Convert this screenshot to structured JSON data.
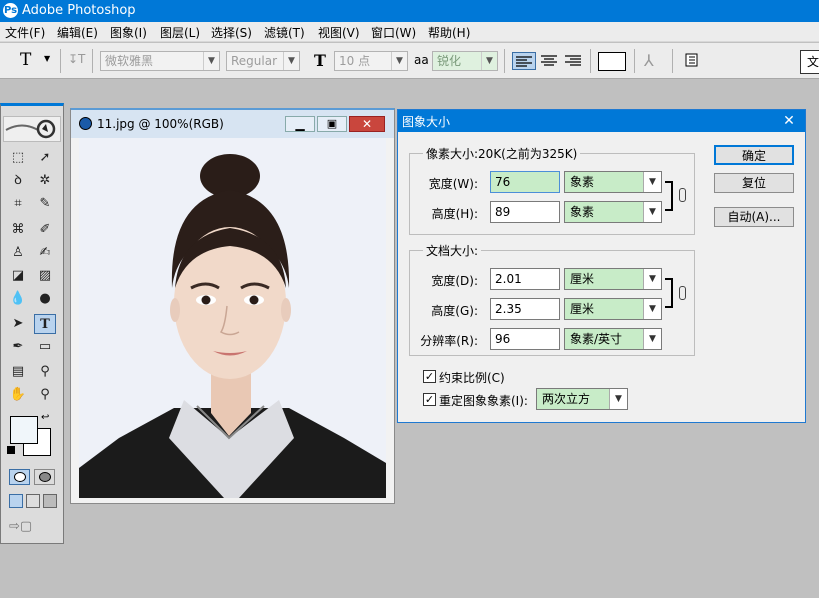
{
  "app": {
    "title": "Adobe Photoshop",
    "icon": "photoshop-icon"
  },
  "menu": [
    "文件(F)",
    "编辑(E)",
    "图象(I)",
    "图层(L)",
    "选择(S)",
    "滤镜(T)",
    "视图(V)",
    "窗口(W)",
    "帮助(H)"
  ],
  "options": {
    "tool_glyph": "T",
    "font_family": "微软雅黑",
    "font_style": "Regular",
    "size_icon": "T",
    "font_size": "10 点",
    "aa_icon": "aa",
    "antialias": "锐化",
    "right_tab": "文"
  },
  "document": {
    "title": "11.jpg @ 100%(RGB)"
  },
  "dialog": {
    "title": "图象大小",
    "pixel_group": "像素大小:20K(之前为325K)",
    "width_label": "宽度(W):",
    "width_value": "76",
    "width_unit": "象素",
    "height_label": "高度(H):",
    "height_value": "89",
    "height_unit": "象素",
    "doc_group": "文档大小:",
    "doc_width_label": "宽度(D):",
    "doc_width_value": "2.01",
    "doc_width_unit": "厘米",
    "doc_height_label": "高度(G):",
    "doc_height_value": "2.35",
    "doc_height_unit": "厘米",
    "resolution_label": "分辨率(R):",
    "resolution_value": "96",
    "resolution_unit": "象素/英寸",
    "constrain_label": "约束比例(C)",
    "constrain_checked": true,
    "resample_label": "重定图象象素(I):",
    "resample_checked": true,
    "resample_method": "两次立方",
    "ok_label": "确定",
    "reset_label": "复位",
    "auto_label": "自动(A)...",
    "check_mark": "✓"
  },
  "colors": {
    "titlebar": "#0078d7",
    "field_highlight": "#c8ecc8"
  }
}
